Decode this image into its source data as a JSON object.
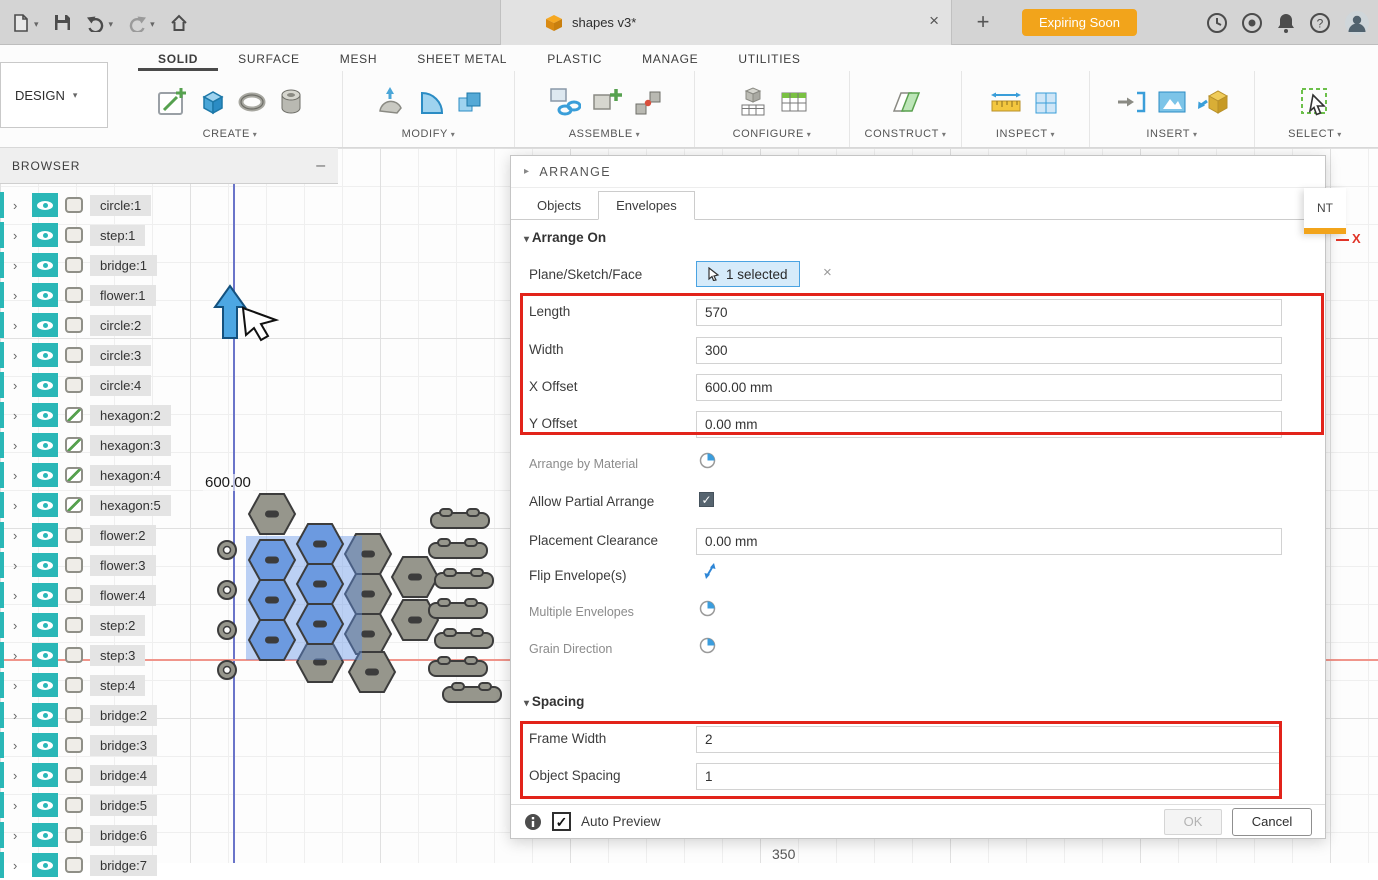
{
  "titlebar": {
    "doc_title": "shapes v3*",
    "close_label": "×",
    "new_tab_label": "+",
    "expiring_label": "Expiring Soon"
  },
  "ribbon": {
    "design_label": "DESIGN",
    "tabs": [
      {
        "label": "SOLID"
      },
      {
        "label": "SURFACE"
      },
      {
        "label": "MESH"
      },
      {
        "label": "SHEET METAL"
      },
      {
        "label": "PLASTIC"
      },
      {
        "label": "MANAGE"
      },
      {
        "label": "UTILITIES"
      }
    ],
    "groups": [
      {
        "label": "CREATE"
      },
      {
        "label": "MODIFY"
      },
      {
        "label": "ASSEMBLE"
      },
      {
        "label": "CONFIGURE"
      },
      {
        "label": "CONSTRUCT"
      },
      {
        "label": "INSPECT"
      },
      {
        "label": "INSERT"
      },
      {
        "label": "SELECT"
      }
    ]
  },
  "browser": {
    "title": "BROWSER",
    "collapse_label": "–",
    "items": [
      {
        "label": "circle:1"
      },
      {
        "label": "step:1"
      },
      {
        "label": "bridge:1"
      },
      {
        "label": "flower:1"
      },
      {
        "label": "circle:2"
      },
      {
        "label": "circle:3"
      },
      {
        "label": "circle:4"
      },
      {
        "label": "hexagon:2"
      },
      {
        "label": "hexagon:3"
      },
      {
        "label": "hexagon:4"
      },
      {
        "label": "hexagon:5"
      },
      {
        "label": "flower:2"
      },
      {
        "label": "flower:3"
      },
      {
        "label": "flower:4"
      },
      {
        "label": "step:2"
      },
      {
        "label": "step:3"
      },
      {
        "label": "step:4"
      },
      {
        "label": "bridge:2"
      },
      {
        "label": "bridge:3"
      },
      {
        "label": "bridge:4"
      },
      {
        "label": "bridge:5"
      },
      {
        "label": "bridge:6"
      },
      {
        "label": "bridge:7"
      }
    ]
  },
  "canvas": {
    "dim_label": "600.00",
    "ruler_label": "350",
    "axis_x_label": "X",
    "comment_fragment": "NT"
  },
  "dialog": {
    "title": "ARRANGE",
    "tab_objects": "Objects",
    "tab_envelopes": "Envelopes",
    "section_arrange_on": "Arrange On",
    "plane_label": "Plane/Sketch/Face",
    "plane_selected": "1 selected",
    "plane_clear": "×",
    "length_label": "Length",
    "length_value": "570",
    "width_label": "Width",
    "width_value": "300",
    "x_offset_label": "X Offset",
    "x_offset_value": "600.00 mm",
    "y_offset_label": "Y Offset",
    "y_offset_value": "0.00 mm",
    "material_label": "Arrange by Material",
    "partial_label": "Allow Partial Arrange",
    "clearance_label": "Placement Clearance",
    "clearance_value": "0.00 mm",
    "flip_label": "Flip Envelope(s)",
    "multiple_label": "Multiple Envelopes",
    "grain_label": "Grain Direction",
    "section_spacing": "Spacing",
    "frame_label": "Frame Width",
    "frame_value": "2",
    "object_label": "Object Spacing",
    "object_value": "1",
    "auto_preview_label": "Auto Preview",
    "ok_label": "OK",
    "cancel_label": "Cancel"
  }
}
